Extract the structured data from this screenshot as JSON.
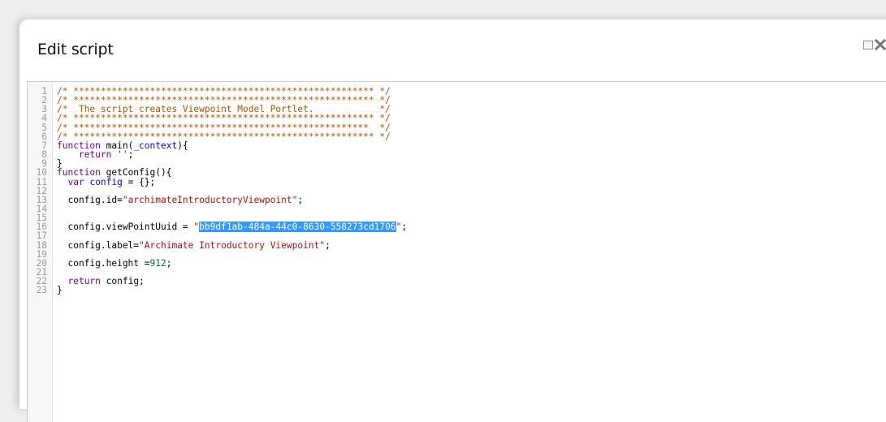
{
  "dialog": {
    "title": "Edit script"
  },
  "editor": {
    "lines": [
      {
        "n": "1",
        "parts": [
          {
            "t": "/* ******************************************************* */",
            "c": "c"
          }
        ]
      },
      {
        "n": "2",
        "parts": [
          {
            "t": "/* ******************************************************* */",
            "c": "c"
          }
        ]
      },
      {
        "n": "3",
        "parts": [
          {
            "t": "/*  The script creates Viewpoint Model Portlet.            */",
            "c": "c"
          }
        ]
      },
      {
        "n": "4",
        "parts": [
          {
            "t": "/* ******************************************************* */",
            "c": "c"
          }
        ]
      },
      {
        "n": "5",
        "parts": [
          {
            "t": "/* ******************************************************  */",
            "c": "c"
          }
        ]
      },
      {
        "n": "6",
        "parts": [
          {
            "t": "/* ******************************************************* */",
            "c": "c"
          }
        ]
      },
      {
        "n": "7",
        "parts": [
          {
            "t": "function",
            "c": "kw"
          },
          {
            "t": " main(",
            "c": "plain"
          },
          {
            "t": "_context",
            "c": "var"
          },
          {
            "t": "){",
            "c": "plain"
          }
        ]
      },
      {
        "n": "8",
        "parts": [
          {
            "t": "    ",
            "c": "plain"
          },
          {
            "t": "return",
            "c": "kw"
          },
          {
            "t": " ",
            "c": "plain"
          },
          {
            "t": "''",
            "c": "str"
          },
          {
            "t": ";",
            "c": "plain"
          }
        ]
      },
      {
        "n": "9",
        "parts": [
          {
            "t": "}",
            "c": "plain"
          }
        ]
      },
      {
        "n": "10",
        "parts": [
          {
            "t": "function",
            "c": "kw"
          },
          {
            "t": " getConfig(){",
            "c": "plain"
          }
        ]
      },
      {
        "n": "11",
        "parts": [
          {
            "t": "  ",
            "c": "plain"
          },
          {
            "t": "var",
            "c": "kw"
          },
          {
            "t": " ",
            "c": "plain"
          },
          {
            "t": "config",
            "c": "var"
          },
          {
            "t": " = {};",
            "c": "plain"
          }
        ]
      },
      {
        "n": "12",
        "parts": []
      },
      {
        "n": "13",
        "parts": [
          {
            "t": "  config.id=",
            "c": "plain"
          },
          {
            "t": "\"archimateIntroductoryViewpoint\"",
            "c": "str"
          },
          {
            "t": ";",
            "c": "plain"
          }
        ]
      },
      {
        "n": "14",
        "parts": []
      },
      {
        "n": "15",
        "parts": []
      },
      {
        "n": "16",
        "parts": [
          {
            "t": "  config.viewPointUuid = ",
            "c": "plain"
          },
          {
            "t": "\"",
            "c": "str"
          },
          {
            "t": "bb9df1ab-484a-44c0-8630-558273cd1706",
            "c": "sel"
          },
          {
            "t": "\"",
            "c": "str"
          },
          {
            "t": ";",
            "c": "plain"
          }
        ]
      },
      {
        "n": "17",
        "parts": []
      },
      {
        "n": "18",
        "parts": [
          {
            "t": "  config.label=",
            "c": "plain"
          },
          {
            "t": "\"Archimate Introductory Viewpoint\"",
            "c": "str"
          },
          {
            "t": ";",
            "c": "plain"
          }
        ]
      },
      {
        "n": "19",
        "parts": []
      },
      {
        "n": "20",
        "parts": [
          {
            "t": "  config.height =",
            "c": "plain"
          },
          {
            "t": "912",
            "c": "num"
          },
          {
            "t": ";",
            "c": "plain"
          }
        ]
      },
      {
        "n": "21",
        "parts": []
      },
      {
        "n": "22",
        "parts": [
          {
            "t": "  ",
            "c": "plain"
          },
          {
            "t": "return",
            "c": "kw"
          },
          {
            "t": " config;",
            "c": "plain"
          }
        ]
      },
      {
        "n": "23",
        "parts": [
          {
            "t": "}",
            "c": "plain"
          }
        ]
      }
    ],
    "selection_color": "#3399ff"
  },
  "icons": {
    "maximize": "maximize-icon",
    "close": "close-icon"
  }
}
